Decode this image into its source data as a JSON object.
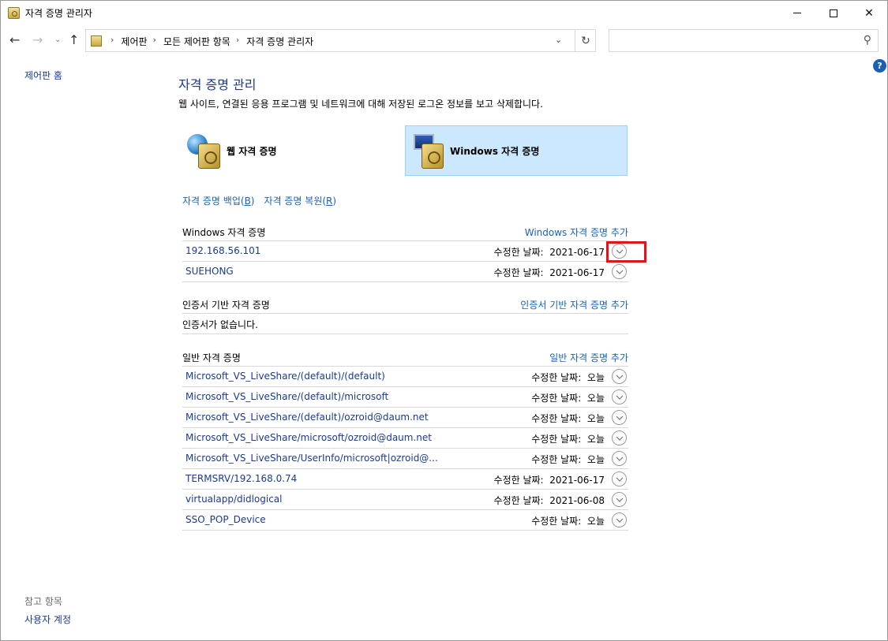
{
  "window": {
    "title": "자격 증명 관리자"
  },
  "nav": {
    "breadcrumb": [
      "제어판",
      "모든 제어판 항목",
      "자격 증명 관리자"
    ],
    "search_placeholder": ""
  },
  "left": {
    "home": "제어판 홈",
    "see_also": "참고 항목",
    "user_accounts": "사용자 계정"
  },
  "main": {
    "title": "자격 증명 관리",
    "subtitle": "웹 사이트, 연결된 응용 프로그램 및 네트워크에 대해 저장된 로그온 정보를 보고 삭제합니다.",
    "tabs": [
      {
        "label": "웹 자격 증명",
        "selected": false
      },
      {
        "label": "Windows 자격 증명",
        "selected": true
      }
    ],
    "backup_link": "자격 증명 백업(",
    "backup_key": "B",
    "restore_link": "자격 증명 복원(",
    "restore_key": "R",
    "close_paren": ")"
  },
  "windows_creds": {
    "title": "Windows 자격 증명",
    "add": "Windows 자격 증명 추가",
    "items": [
      {
        "name": "192.168.56.101",
        "modified_label": "수정한 날짜:",
        "modified": "2021-06-17"
      },
      {
        "name": "SUEHONG",
        "modified_label": "수정한 날짜:",
        "modified": "2021-06-17"
      }
    ]
  },
  "cert_creds": {
    "title": "인증서 기반 자격 증명",
    "add": "인증서 기반 자격 증명 추가",
    "empty": "인증서가 없습니다."
  },
  "generic_creds": {
    "title": "일반 자격 증명",
    "add": "일반 자격 증명 추가",
    "items": [
      {
        "name": "Microsoft_VS_LiveShare/(default)/(default)",
        "modified_label": "수정한 날짜:",
        "modified": "오늘"
      },
      {
        "name": "Microsoft_VS_LiveShare/(default)/microsoft",
        "modified_label": "수정한 날짜:",
        "modified": "오늘"
      },
      {
        "name": "Microsoft_VS_LiveShare/(default)/ozroid@daum.net",
        "modified_label": "수정한 날짜:",
        "modified": "오늘"
      },
      {
        "name": "Microsoft_VS_LiveShare/microsoft/ozroid@daum.net",
        "modified_label": "수정한 날짜:",
        "modified": "오늘"
      },
      {
        "name": "Microsoft_VS_LiveShare/UserInfo/microsoft|ozroid@...",
        "modified_label": "수정한 날짜:",
        "modified": "오늘"
      },
      {
        "name": "TERMSRV/192.168.0.74",
        "modified_label": "수정한 날짜:",
        "modified": "2021-06-17"
      },
      {
        "name": "virtualapp/didlogical",
        "modified_label": "수정한 날짜:",
        "modified": "2021-06-08"
      },
      {
        "name": "SSO_POP_Device",
        "modified_label": "수정한 날짜:",
        "modified": "오늘"
      }
    ]
  },
  "colors": {
    "link": "#1c62b0",
    "highlight": "#e0141c",
    "selected_tab": "#cce8ff"
  }
}
